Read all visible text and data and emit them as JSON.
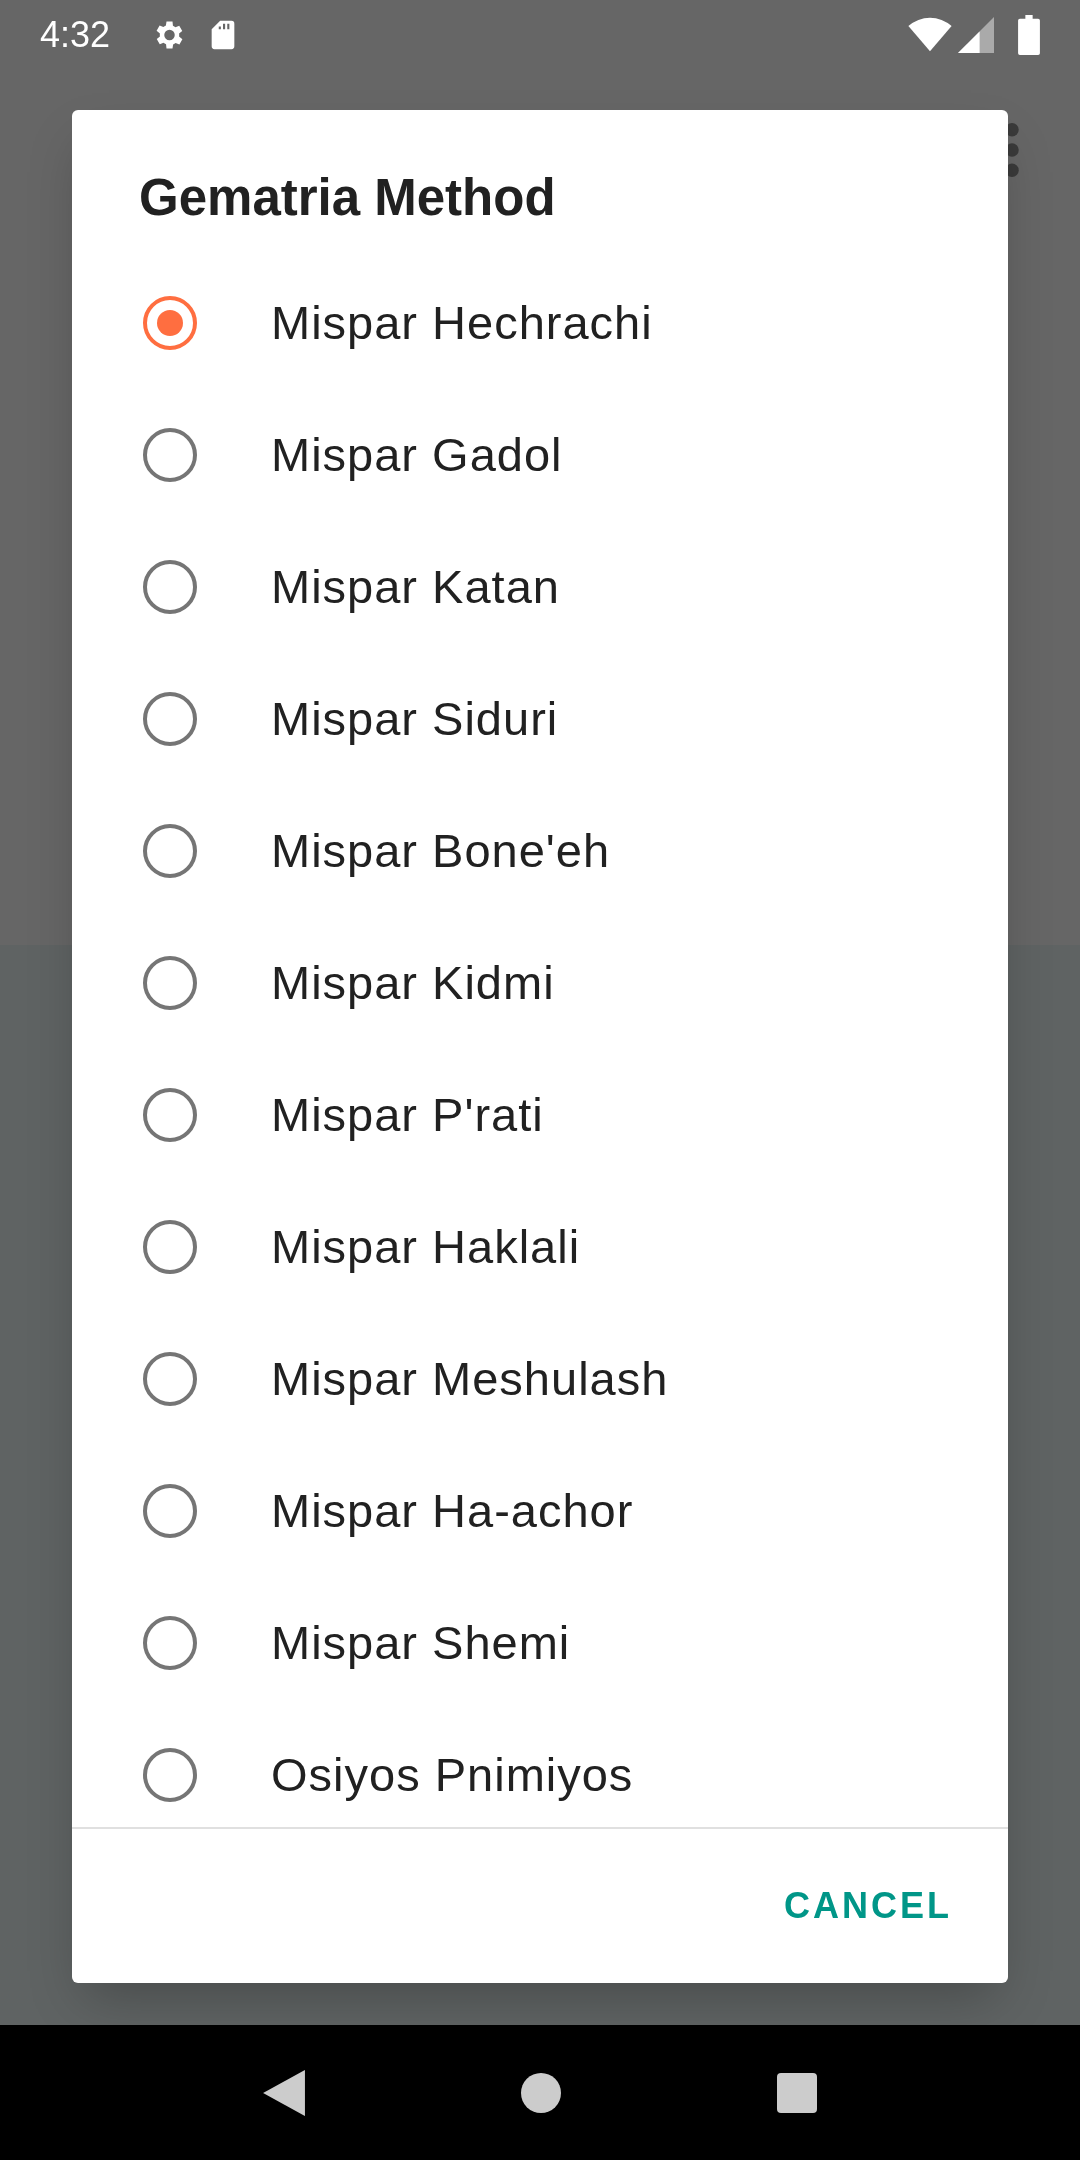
{
  "status_bar": {
    "time": "4:32"
  },
  "dialog": {
    "title": "Gematria Method",
    "options": [
      {
        "label": "Mispar Hechrachi",
        "selected": true
      },
      {
        "label": "Mispar Gadol",
        "selected": false
      },
      {
        "label": "Mispar Katan",
        "selected": false
      },
      {
        "label": "Mispar Siduri",
        "selected": false
      },
      {
        "label": "Mispar Bone'eh",
        "selected": false
      },
      {
        "label": "Mispar Kidmi",
        "selected": false
      },
      {
        "label": "Mispar P'rati",
        "selected": false
      },
      {
        "label": "Mispar Haklali",
        "selected": false
      },
      {
        "label": "Mispar Meshulash",
        "selected": false
      },
      {
        "label": "Mispar Ha-achor",
        "selected": false
      },
      {
        "label": "Mispar Shemi",
        "selected": false
      },
      {
        "label": "Osiyos Pnimiyos",
        "selected": false
      }
    ],
    "buttons": [
      "CANCEL"
    ]
  }
}
